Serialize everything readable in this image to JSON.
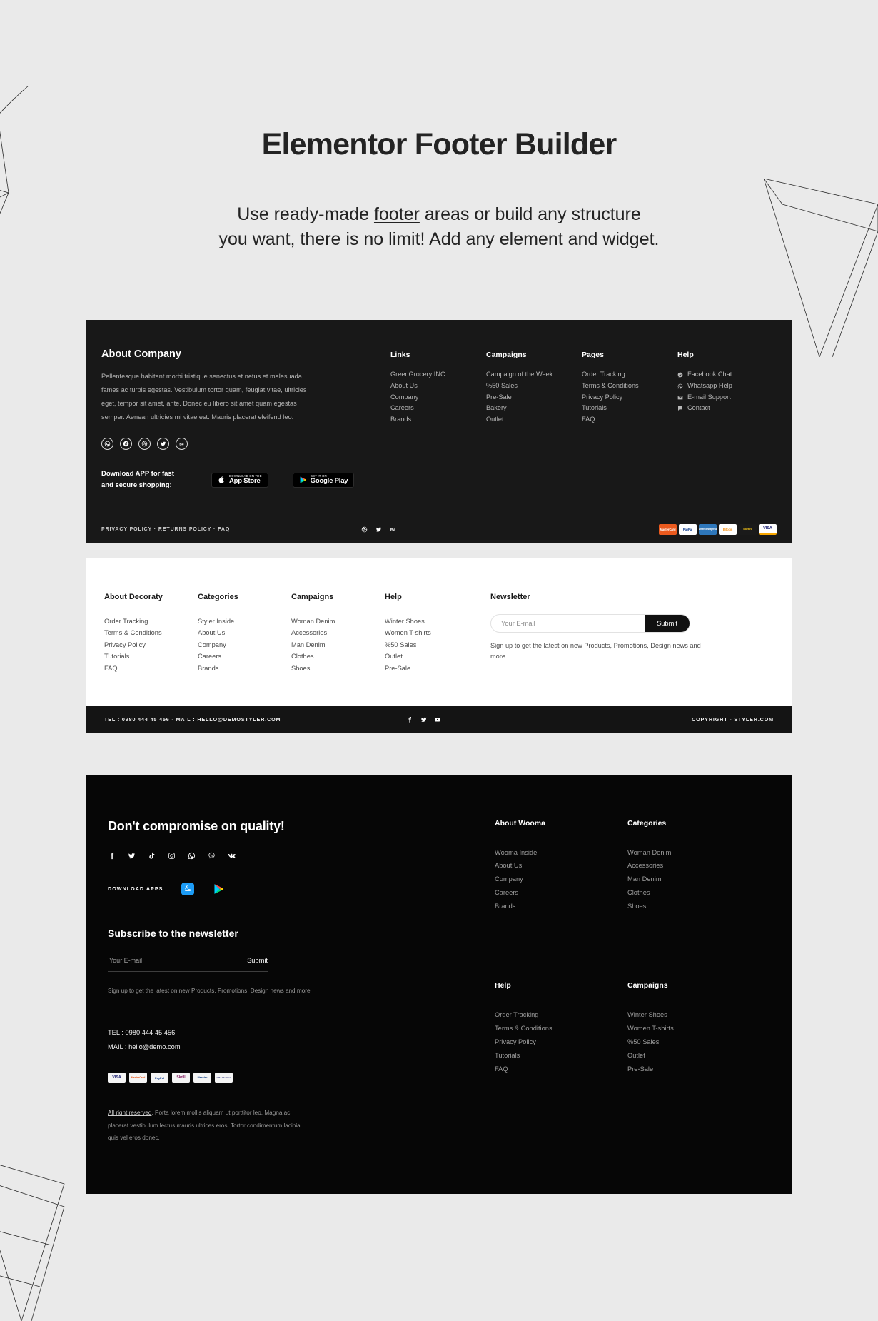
{
  "hero": {
    "title": "Elementor Footer Builder",
    "line1_a": "Use ready-made ",
    "line1_u": "footer",
    "line1_b": " areas or build any structure",
    "line2": "you want, there is no limit! Add any element and widget."
  },
  "footer_one": {
    "about": {
      "heading": "About Company",
      "text": "Pellentesque habitant morbi tristique senectus et netus et malesuada fames ac turpis egestas. Vestibulum tortor quam, feugiat vitae, ultricies eget, tempor sit amet, ante. Donec eu libero sit amet quam egestas semper. Aenean ultricies mi vitae est. Mauris placerat eleifend leo.",
      "social": [
        "whatsapp-icon",
        "facebook-icon",
        "dribbble-icon",
        "twitter-icon",
        "behance-icon"
      ]
    },
    "app": {
      "text_line1": "Download APP for fast",
      "text_line2": "and secure shopping:",
      "apple_sub": "Download on the",
      "apple_main": "App Store",
      "google_sub": "GET IT ON",
      "google_main": "Google Play"
    },
    "columns": [
      {
        "heading": "Links",
        "items": [
          "GreenGrocery INC",
          "About Us",
          "Company",
          "Careers",
          "Brands"
        ]
      },
      {
        "heading": "Campaigns",
        "items": [
          "Campaign of the Week",
          "%50 Sales",
          "Pre-Sale",
          "Bakery",
          "Outlet"
        ]
      },
      {
        "heading": "Pages",
        "items": [
          "Order Tracking",
          "Terms & Conditions",
          "Privacy Policy",
          "Tutorials",
          "FAQ"
        ]
      }
    ],
    "help": {
      "heading": "Help",
      "items": [
        {
          "label": "Facebook Chat",
          "icon": "messenger-icon"
        },
        {
          "label": "Whatsapp Help",
          "icon": "whatsapp-icon"
        },
        {
          "label": "E-mail Support",
          "icon": "envelope-icon"
        },
        {
          "label": "Contact",
          "icon": "chat-bubble-icon"
        }
      ]
    },
    "bottom": {
      "legal": "PRIVACY POLICY · RETURNS POLICY · FAQ",
      "social": [
        "dribbble-icon",
        "twitter-icon",
        "behance-icon"
      ],
      "payments": [
        "MasterCard",
        "PayPal",
        "AmericanExpress",
        "Bitcoin",
        "Maestro",
        "VISA"
      ]
    }
  },
  "footer_two": {
    "columns": [
      {
        "heading": "About Decoraty",
        "items": [
          "Order Tracking",
          "Terms & Conditions",
          "Privacy Policy",
          "Tutorials",
          "FAQ"
        ]
      },
      {
        "heading": "Categories",
        "items": [
          "Styler Inside",
          "About Us",
          "Company",
          "Careers",
          "Brands"
        ]
      },
      {
        "heading": "Campaigns",
        "items": [
          "Woman Denim",
          "Accessories",
          "Man Denim",
          "Clothes",
          "Shoes"
        ]
      },
      {
        "heading": "Help",
        "items": [
          "Winter Shoes",
          "Women T-shirts",
          "%50 Sales",
          "Outlet",
          "Pre-Sale"
        ]
      }
    ],
    "newsletter": {
      "heading": "Newsletter",
      "placeholder": "Your E-mail",
      "value": "",
      "submit": "Submit",
      "note": "Sign up to get the latest on new Products, Promotions, Design news and more"
    },
    "bottom": {
      "contact": "TEL : 0980 444 45 456  -  MAIL : HELLO@DEMOSTYLER.COM",
      "social": [
        "facebook-icon",
        "twitter-icon",
        "youtube-icon"
      ],
      "copyright": "COPYRIGHT - STYLER.COM"
    }
  },
  "footer_three": {
    "heading": "Don't compromise on quality!",
    "social": [
      "facebook-icon",
      "twitter-icon",
      "tiktok-icon",
      "instagram-icon",
      "whatsapp-icon",
      "viber-icon",
      "vk-icon"
    ],
    "apps_label": "DOWNLOAD APPS",
    "apps": [
      "app-store-icon",
      "google-play-icon"
    ],
    "subscribe": {
      "heading": "Subscribe to the newsletter",
      "placeholder": "Your E-mail",
      "value": "",
      "submit": "Submit",
      "note": "Sign up to get the latest on new Products, Promotions, Design news and more"
    },
    "contact": {
      "tel": "TEL : 0980 444 45 456",
      "mail": "MAIL : hello@demo.com"
    },
    "payments": [
      "VISA",
      "MasterCard",
      "PayPal",
      "Skrill",
      "Maestro",
      "VISA Electron"
    ],
    "rights_link": "All right reserved",
    "rights_text": ". Porta lorem mollis aliquam ut porttitor leo. Magna ac placerat vestibulum lectus mauris ultrices eros. Tortor condimentum lacinia quis vel eros donec.",
    "columns": [
      {
        "heading": "About Wooma",
        "items": [
          "Wooma Inside",
          "About Us",
          "Company",
          "Careers",
          "Brands"
        ]
      },
      {
        "heading": "Categories",
        "items": [
          "Woman Denim",
          "Accessories",
          "Man Denim",
          "Clothes",
          "Shoes"
        ]
      },
      {
        "heading": "Help",
        "items": [
          "Order Tracking",
          "Terms & Conditions",
          "Privacy Policy",
          "Tutorials",
          "FAQ"
        ]
      },
      {
        "heading": "Campaigns",
        "items": [
          "Winter Shoes",
          "Women T-shirts",
          "%50 Sales",
          "Outlet",
          "Pre-Sale"
        ]
      }
    ]
  },
  "colors": {
    "page_bg": "#eaeaea",
    "dark_panel": "#181818",
    "black_panel": "#060606",
    "light_panel": "#ffffff",
    "text_dark": "#232323",
    "muted": "#b4b4b4"
  }
}
